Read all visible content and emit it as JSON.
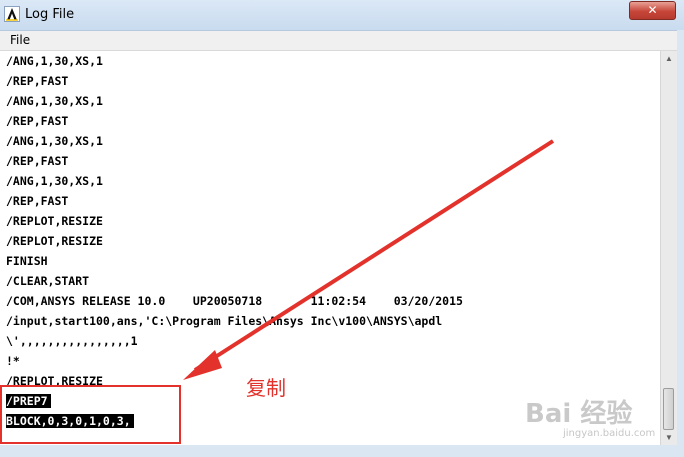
{
  "window": {
    "title": "Log File",
    "close_label": "✕"
  },
  "menu": {
    "file_label": "File"
  },
  "log": {
    "lines": [
      "/ANG,1,30,XS,1",
      "/REP,FAST",
      "/ANG,1,30,XS,1",
      "/REP,FAST",
      "/ANG,1,30,XS,1",
      "/REP,FAST",
      "/ANG,1,30,XS,1",
      "/REP,FAST",
      "/REPLOT,RESIZE",
      "/REPLOT,RESIZE",
      "FINISH",
      "/CLEAR,START",
      "/COM,ANSYS RELEASE 10.0    UP20050718       11:02:54    03/20/2015",
      "/input,start100,ans,'C:\\Program Files\\Ansys Inc\\v100\\ANSYS\\apdl",
      "\\',,,,,,,,,,,,,,,,1",
      "!*",
      "/REPLOT,RESIZE",
      "/PREP7",
      "BLOCK,0,3,0,1,0,3,"
    ],
    "selected_lines": [
      17,
      18
    ]
  },
  "annotation": {
    "label": "复制",
    "color": "#e3322b"
  },
  "watermark": {
    "text": "Bai 经验",
    "sub": "jingyan.baidu.com"
  }
}
